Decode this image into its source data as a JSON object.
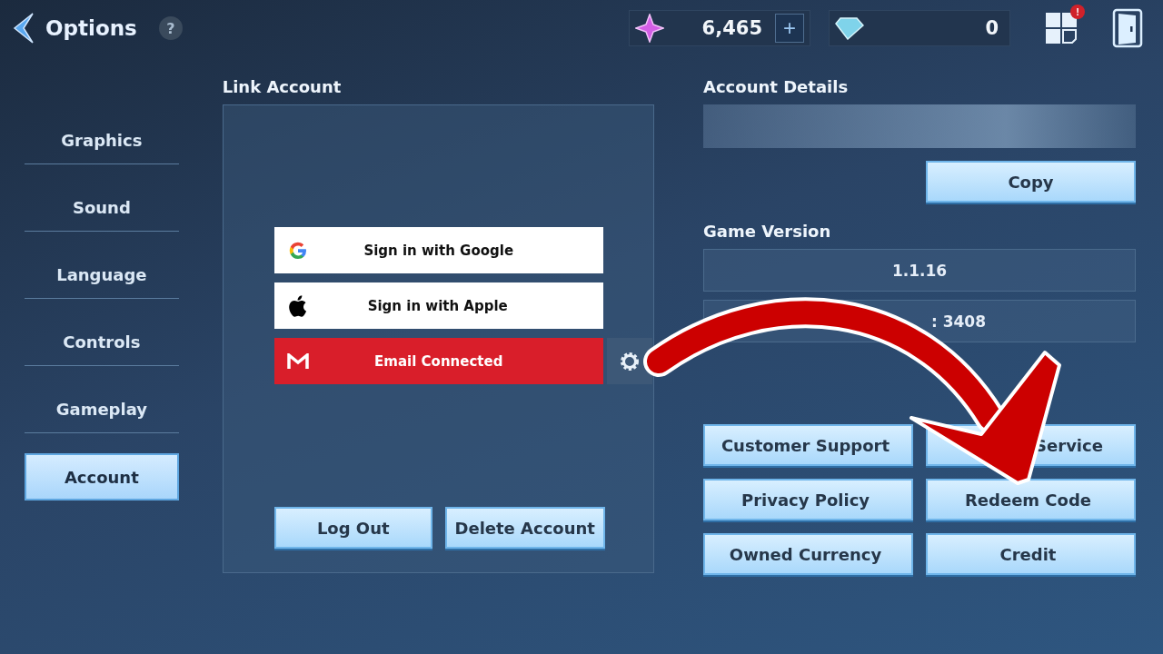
{
  "header": {
    "title": "Options",
    "help": "?",
    "currencies": [
      {
        "kind": "crystal",
        "amount": "6,465",
        "add": "+"
      },
      {
        "kind": "diamond",
        "amount": "0"
      }
    ],
    "notification": "!"
  },
  "sidebar": {
    "items": [
      {
        "label": "Graphics",
        "selected": false
      },
      {
        "label": "Sound",
        "selected": false
      },
      {
        "label": "Language",
        "selected": false
      },
      {
        "label": "Controls",
        "selected": false
      },
      {
        "label": "Gameplay",
        "selected": false
      },
      {
        "label": "Account",
        "selected": true
      }
    ]
  },
  "link_account": {
    "title": "Link Account",
    "providers": [
      {
        "kind": "google",
        "label": "Sign in with Google"
      },
      {
        "kind": "apple",
        "label": "Sign in with Apple"
      },
      {
        "kind": "email",
        "label": "Email Connected"
      }
    ],
    "buttons": [
      "Log Out",
      "Delete Account"
    ]
  },
  "account_details": {
    "title": "Account Details",
    "copy": "Copy"
  },
  "game_version": {
    "title": "Game Version",
    "version": "1.1.16",
    "build": ": 3408"
  },
  "links": [
    {
      "label": "Customer Support",
      "covered": false
    },
    {
      "label": "Service",
      "covered": true
    },
    {
      "label": "Privacy Policy",
      "covered": false
    },
    {
      "label": "Redeem Code",
      "covered": false
    },
    {
      "label": "Owned Currency",
      "covered": false
    },
    {
      "label": "Credit",
      "covered": false
    }
  ]
}
